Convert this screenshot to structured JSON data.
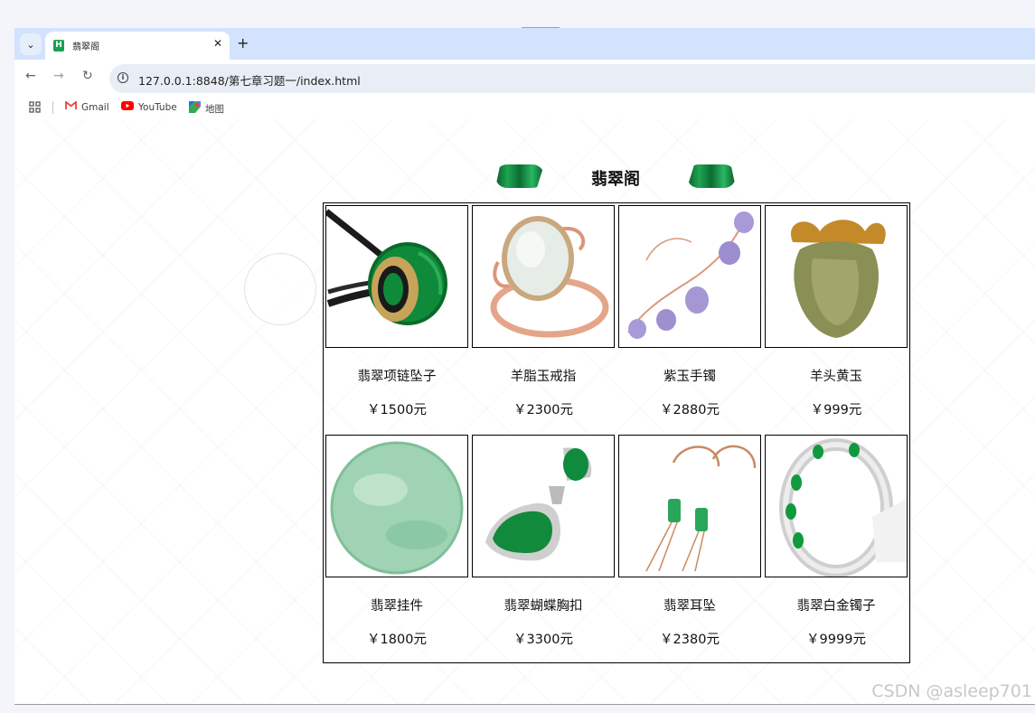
{
  "browser": {
    "tab_title": "翡翠阁",
    "favicon_letter": "H",
    "url": "127.0.0.1:8848/第七章习题一/index.html",
    "bookmarks": [
      "Gmail",
      "YouTube",
      "地图"
    ]
  },
  "page": {
    "title": "翡翠阁",
    "products": [
      {
        "name": "翡翠项链坠子",
        "price": "￥1500元",
        "icon": "jade-ring-pendant"
      },
      {
        "name": "羊脂玉戒指",
        "price": "￥2300元",
        "icon": "white-jade-ring"
      },
      {
        "name": "紫玉手镯",
        "price": "￥2880元",
        "icon": "purple-jade-bracelet"
      },
      {
        "name": "羊头黄玉",
        "price": "￥999元",
        "icon": "yellow-jade-carving"
      },
      {
        "name": "翡翠挂件",
        "price": "￥1800元",
        "icon": "round-jade-pendant"
      },
      {
        "name": "翡翠蝴蝶胸扣",
        "price": "￥3300元",
        "icon": "jade-brooch"
      },
      {
        "name": "翡翠耳坠",
        "price": "￥2380元",
        "icon": "jade-earrings"
      },
      {
        "name": "翡翠白金镯子",
        "price": "￥9999元",
        "icon": "platinum-jade-bangle"
      }
    ]
  },
  "watermark": "CSDN @asleep701",
  "colors": {
    "jade": "#1a9a4a",
    "tabbar": "#d3e3fd",
    "omnibox": "#e9eef6"
  }
}
